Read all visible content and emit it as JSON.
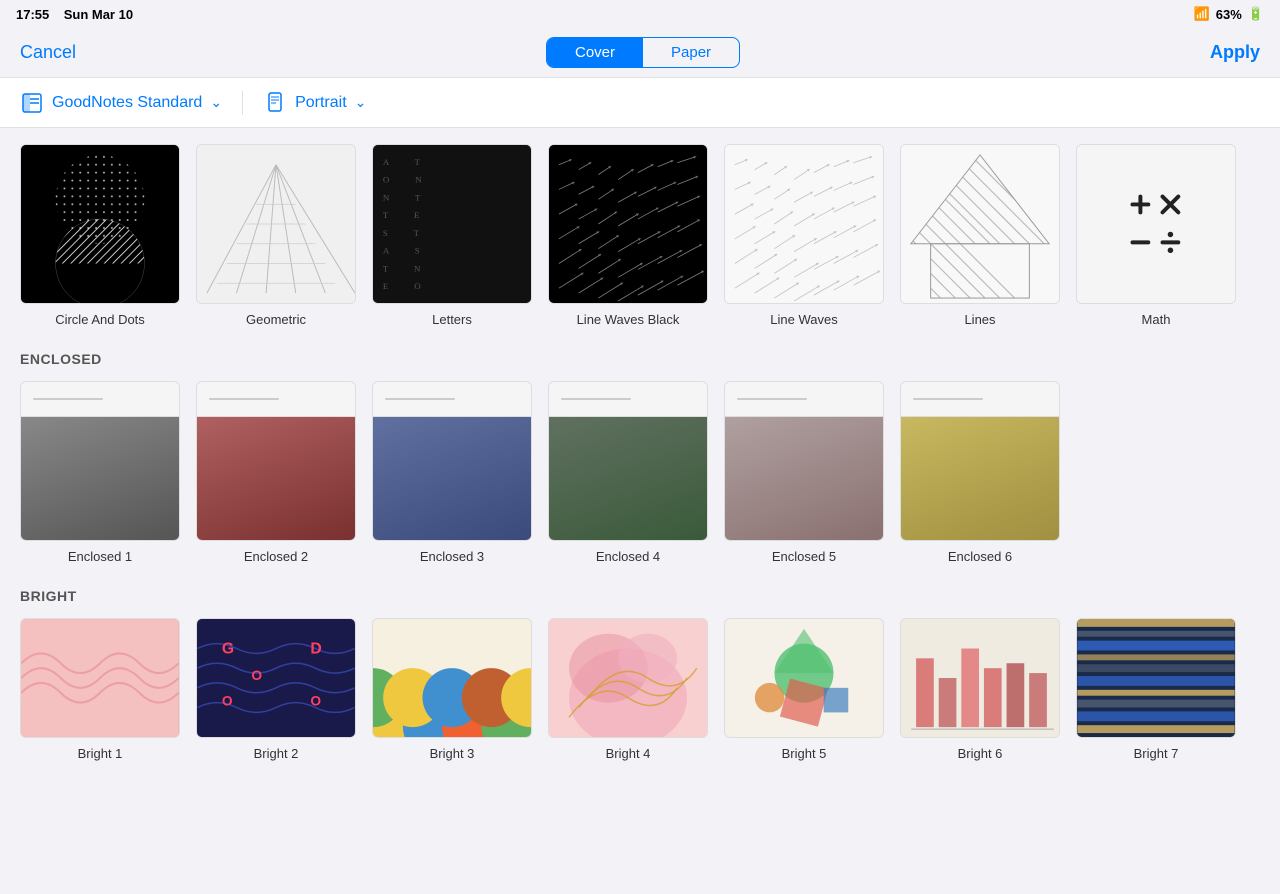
{
  "statusBar": {
    "time": "17:55",
    "date": "Sun Mar 10",
    "signal": "WiFi",
    "battery": "63%"
  },
  "navBar": {
    "cancelLabel": "Cancel",
    "applyLabel": "Apply",
    "tabs": [
      {
        "id": "cover",
        "label": "Cover",
        "active": true
      },
      {
        "id": "paper",
        "label": "Paper",
        "active": false
      }
    ]
  },
  "filterBar": {
    "template": "GoodNotes Standard",
    "orientation": "Portrait"
  },
  "sections": {
    "unnamed": {
      "covers": [
        {
          "id": "circle-dots",
          "label": "Circle And Dots"
        },
        {
          "id": "geometric",
          "label": "Geometric"
        },
        {
          "id": "letters",
          "label": "Letters"
        },
        {
          "id": "line-waves-black",
          "label": "Line Waves Black"
        },
        {
          "id": "line-waves",
          "label": "Line Waves"
        },
        {
          "id": "lines",
          "label": "Lines"
        },
        {
          "id": "math",
          "label": "Math"
        }
      ]
    },
    "enclosed": {
      "title": "ENCLOSED",
      "covers": [
        {
          "id": "enclosed-1",
          "label": "Enclosed 1"
        },
        {
          "id": "enclosed-2",
          "label": "Enclosed 2"
        },
        {
          "id": "enclosed-3",
          "label": "Enclosed 3"
        },
        {
          "id": "enclosed-4",
          "label": "Enclosed 4"
        },
        {
          "id": "enclosed-5",
          "label": "Enclosed 5"
        },
        {
          "id": "enclosed-6",
          "label": "Enclosed 6"
        }
      ]
    },
    "bright": {
      "title": "BRIGHT",
      "covers": [
        {
          "id": "bright-1",
          "label": "Bright 1"
        },
        {
          "id": "bright-2",
          "label": "Bright 2"
        },
        {
          "id": "bright-3",
          "label": "Bright 3"
        },
        {
          "id": "bright-4",
          "label": "Bright 4"
        },
        {
          "id": "bright-5",
          "label": "Bright 5"
        },
        {
          "id": "bright-6",
          "label": "Bright 6"
        },
        {
          "id": "bright-7",
          "label": "Bright 7"
        }
      ]
    }
  }
}
